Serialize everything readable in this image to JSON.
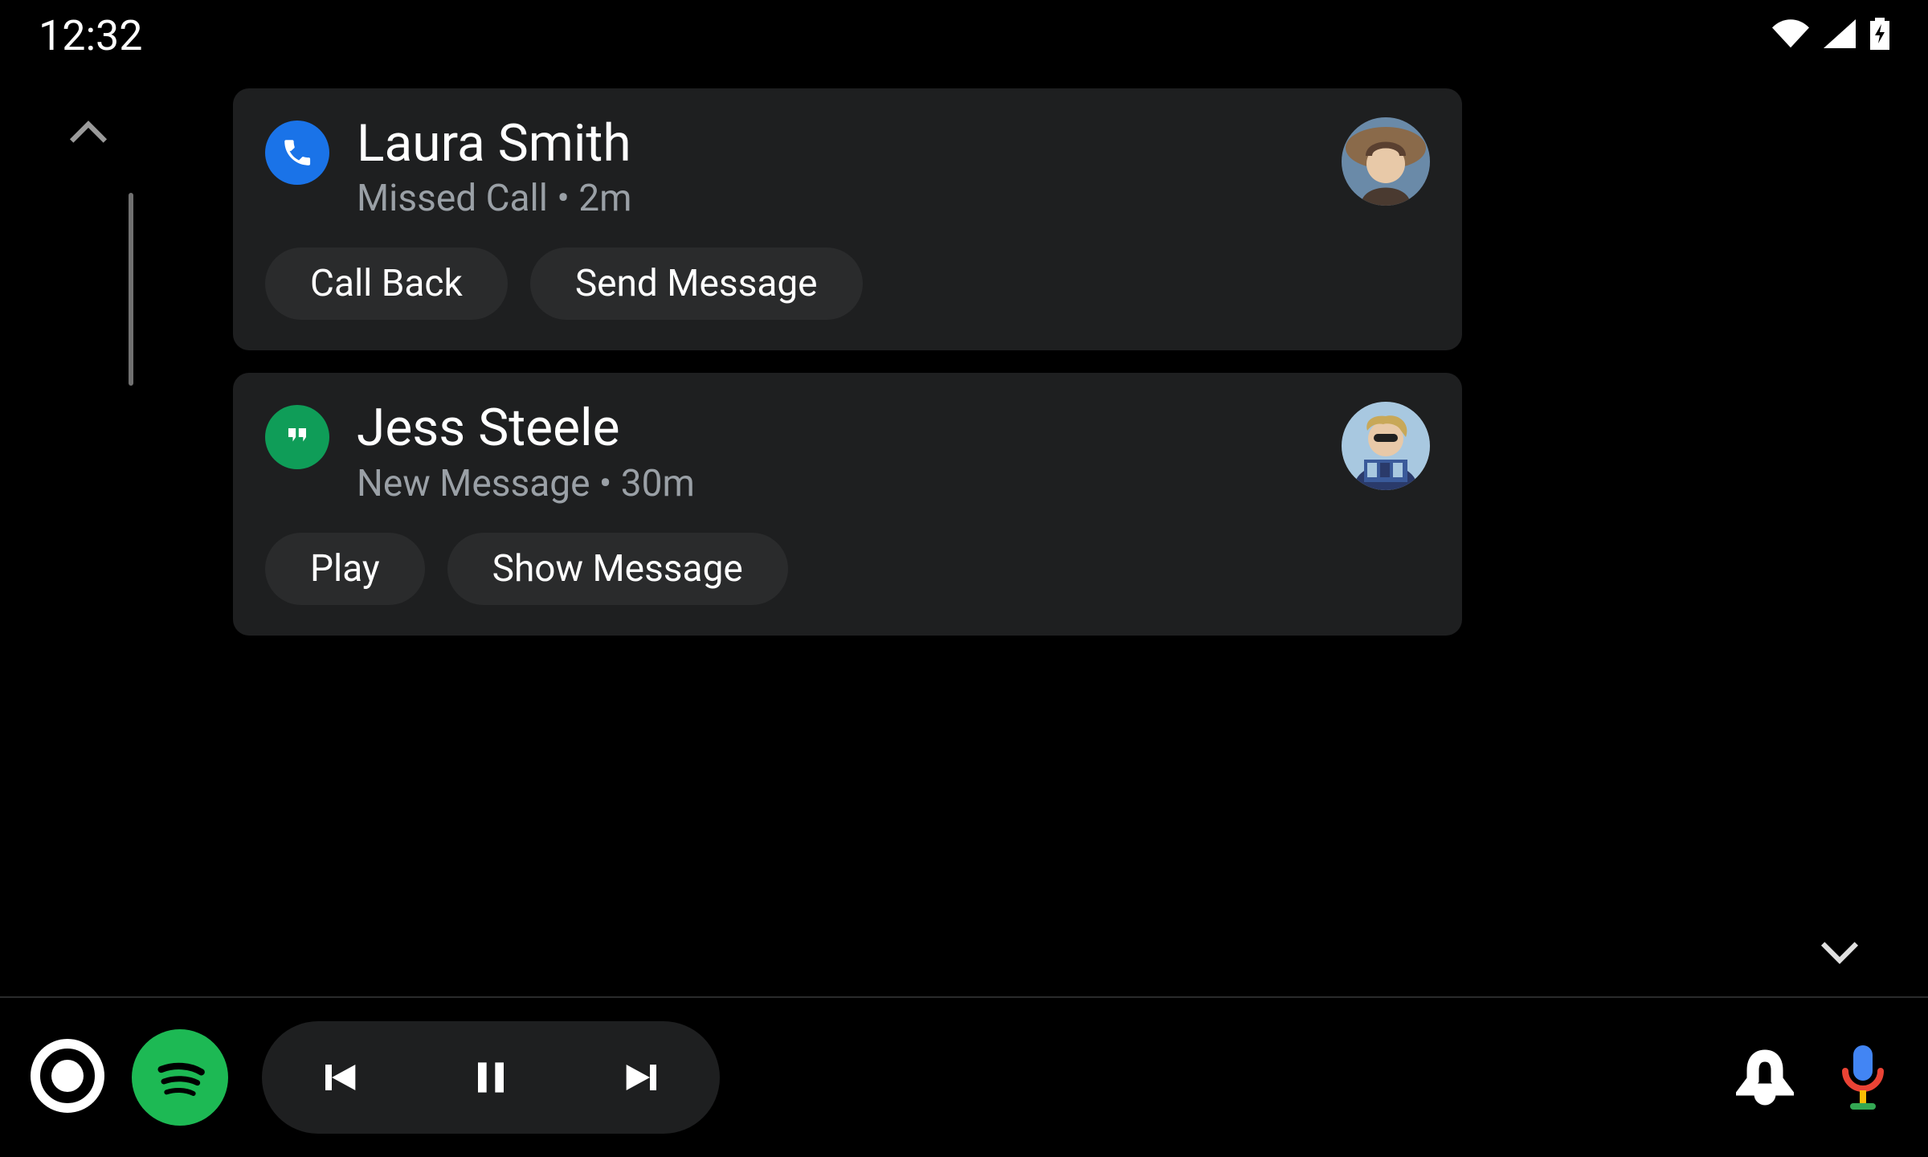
{
  "status_bar": {
    "time": "12:32"
  },
  "notifications": [
    {
      "app": "phone",
      "title": "Laura Smith",
      "subtitle": "Missed Call • 2m",
      "actions": [
        "Call Back",
        "Send Message"
      ]
    },
    {
      "app": "hangouts",
      "title": "Jess Steele",
      "subtitle": "New Message • 30m",
      "actions": [
        "Play",
        "Show Message"
      ]
    }
  ],
  "media": {
    "app": "spotify"
  }
}
